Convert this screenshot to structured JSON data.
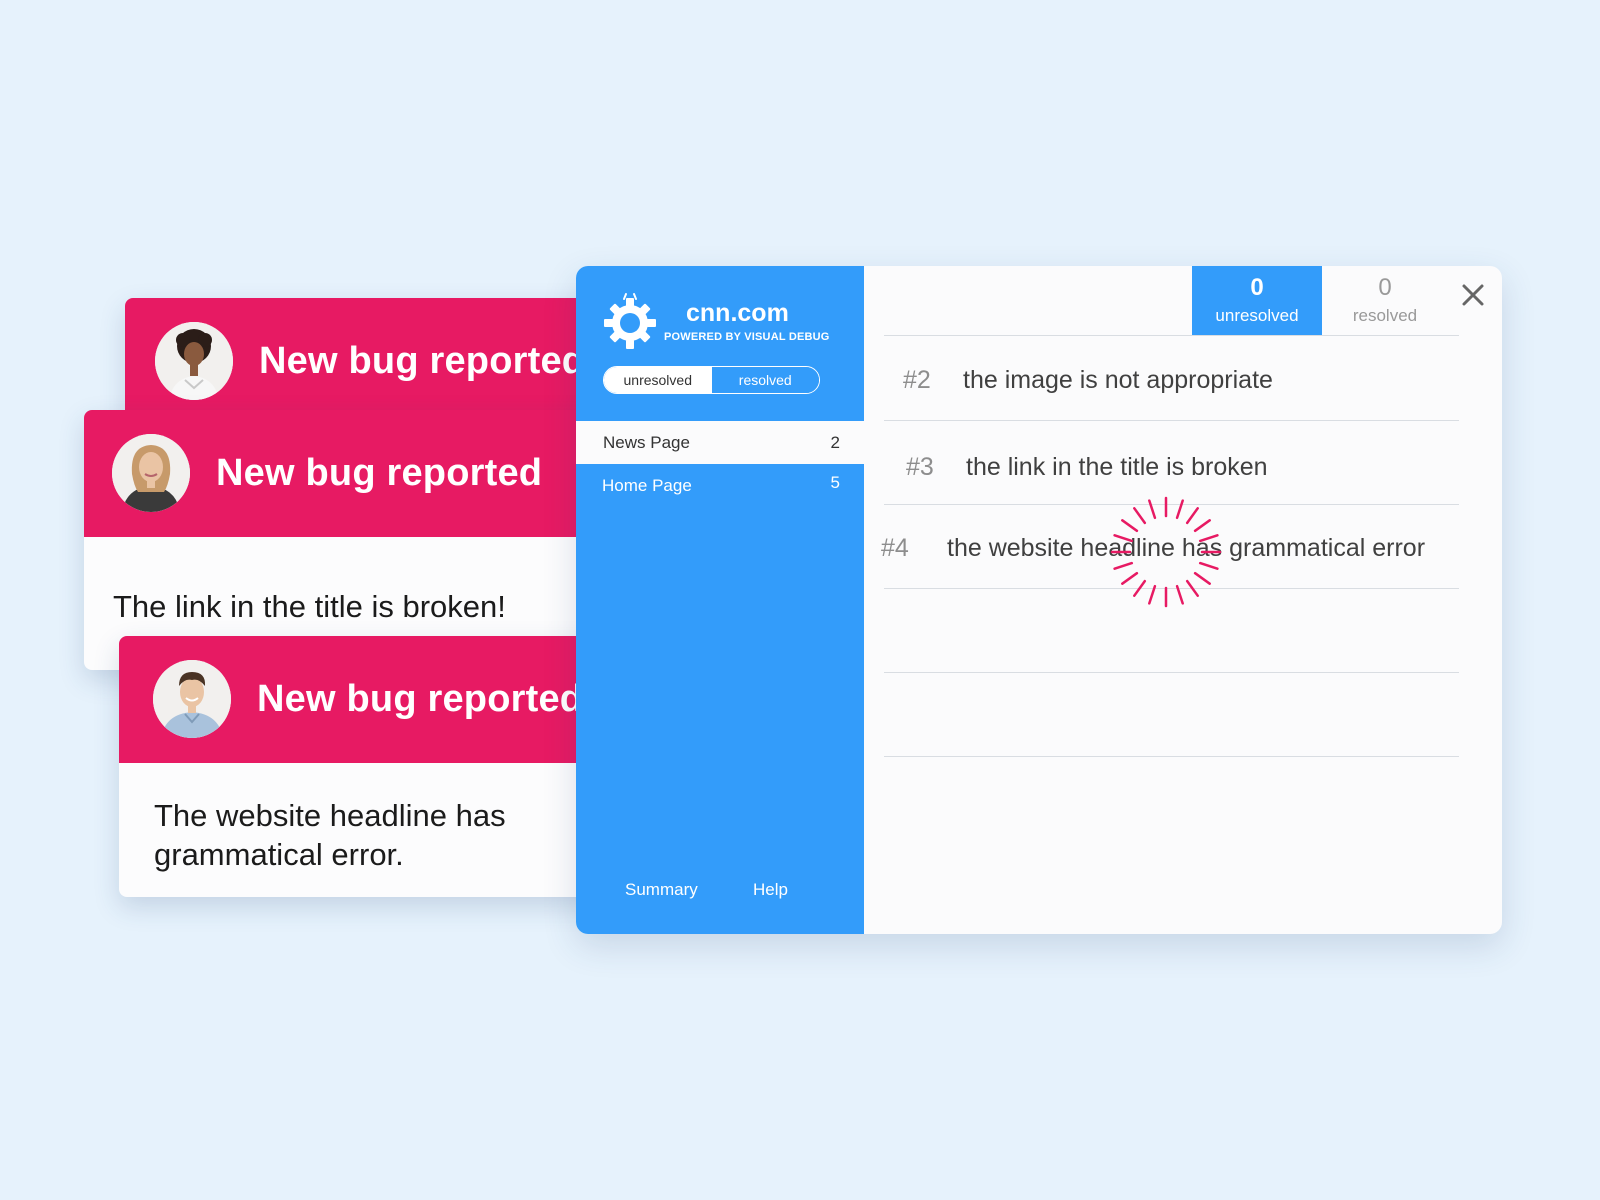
{
  "notifications": [
    {
      "title": "New bug reported",
      "message": ""
    },
    {
      "title": "New bug reported",
      "message": "The link in the title is broken!"
    },
    {
      "title": "New bug reported",
      "message_line1": "The website headline has",
      "message_line2": "grammatical error."
    }
  ],
  "sidebar": {
    "site": "cnn.com",
    "powered_by": "POWERED BY VISUAL DEBUG",
    "toggle": {
      "unresolved": "unresolved",
      "resolved": "resolved"
    },
    "pages": [
      {
        "name": "News Page",
        "count": "2"
      },
      {
        "name": "Home Page",
        "count": "5"
      }
    ],
    "footer": {
      "summary": "Summary",
      "help": "Help"
    }
  },
  "stats": {
    "unresolved": {
      "count": "0",
      "label": "unresolved"
    },
    "resolved": {
      "count": "0",
      "label": "resolved"
    }
  },
  "issues": [
    {
      "number": "#2",
      "text": "the image is not appropriate"
    },
    {
      "number": "#3",
      "text": "the link in the title is broken"
    },
    {
      "number": "#4",
      "text": "the website headline has grammatical error"
    }
  ],
  "colors": {
    "background": "#e6f2fc",
    "notification_red": "#e71a63",
    "sidebar_blue": "#339cfa",
    "panel_white": "#fbfbfc"
  },
  "icons": {
    "logo": "bug-gear-icon",
    "close": "close-icon",
    "burst": "click-burst-icon"
  }
}
